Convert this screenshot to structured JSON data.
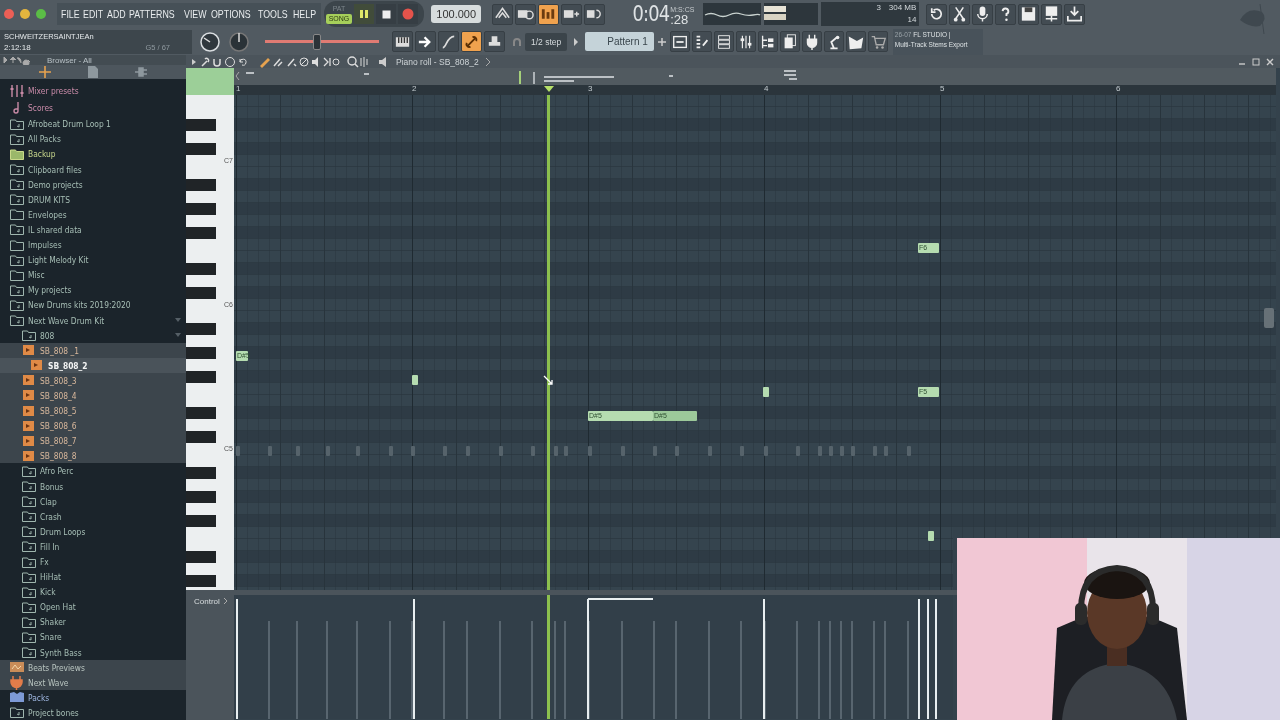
{
  "menu": [
    "FILE",
    "EDIT",
    "ADD",
    "PATTERNS",
    "VIEW",
    "OPTIONS",
    "TOOLS",
    "HELP"
  ],
  "transport": {
    "pat_label": "PAT",
    "song_label": "SONG",
    "song_mode": true,
    "playing": true,
    "tempo": "100.000",
    "time": "0:04",
    "time_small": ":28",
    "time_unit": "M:S:CS"
  },
  "toggles_top": [
    {
      "on": false
    },
    {
      "on": false
    },
    {
      "on": true
    },
    {
      "on": false
    },
    {
      "on": false
    }
  ],
  "toggles_bottom": [
    {
      "on": false
    },
    {
      "on": false
    },
    {
      "on": false
    },
    {
      "on": true
    },
    {
      "on": false
    }
  ],
  "cpu": {
    "value": "3",
    "memory": "304 MB",
    "voices": "14"
  },
  "hint": {
    "title": "SCHWEITZERSAINTJEAn",
    "time": "2:12:18",
    "note": "G5 / 67"
  },
  "pitch_slider": {
    "level": 0.45
  },
  "snap": "1/2 step",
  "pattern": "Pattern 1",
  "news": {
    "date": "26-07",
    "title": "FL STUDIO |",
    "subtitle": "Multi-Track Stems Export"
  },
  "browser": {
    "label": "Browser - All",
    "items": [
      {
        "label": "Mixer presets",
        "kind": "mixer",
        "selected": false
      },
      {
        "label": "Scores",
        "kind": "score",
        "selected": false
      },
      {
        "label": "Afrobeat Drum Loop 1",
        "kind": "folder-link",
        "selected": false
      },
      {
        "label": "All Packs",
        "kind": "folder-link",
        "selected": false
      },
      {
        "label": "Backup",
        "kind": "backup",
        "selected": false
      },
      {
        "label": "Clipboard files",
        "kind": "folder-link",
        "selected": false
      },
      {
        "label": "Demo projects",
        "kind": "folder-link",
        "selected": false
      },
      {
        "label": "DRUM KITS",
        "kind": "folder-link",
        "selected": false
      },
      {
        "label": "Envelopes",
        "kind": "folder",
        "selected": false
      },
      {
        "label": "IL shared data",
        "kind": "folder-link",
        "selected": false
      },
      {
        "label": "Impulses",
        "kind": "folder",
        "selected": false
      },
      {
        "label": "Light Melody Kit",
        "kind": "folder-link",
        "selected": false
      },
      {
        "label": "Misc",
        "kind": "folder",
        "selected": false
      },
      {
        "label": "My projects",
        "kind": "folder-link",
        "selected": false
      },
      {
        "label": "New Drums kits 2019:2020",
        "kind": "folder-link",
        "selected": false
      },
      {
        "label": "Next Wave Drum Kit",
        "kind": "folder-link",
        "selected": false,
        "expanded": true,
        "children": [
          {
            "label": "808",
            "kind": "folder-link",
            "selected": false,
            "expanded": true,
            "children": [
              {
                "label": "SB_808 _1",
                "kind": "sample",
                "selected": false
              },
              {
                "label": "SB_808_2",
                "kind": "sample",
                "selected": true
              },
              {
                "label": "SB_808_3",
                "kind": "sample",
                "selected": false
              },
              {
                "label": "SB_808_4",
                "kind": "sample",
                "selected": false
              },
              {
                "label": "SB_808_5",
                "kind": "sample",
                "selected": false
              },
              {
                "label": "SB_808_6",
                "kind": "sample",
                "selected": false
              },
              {
                "label": "SB_808_7",
                "kind": "sample",
                "selected": false
              },
              {
                "label": "SB_808_8",
                "kind": "sample",
                "selected": false
              }
            ]
          },
          {
            "label": "Afro Perc",
            "kind": "folder-link",
            "selected": false
          },
          {
            "label": "Bonus",
            "kind": "folder-link",
            "selected": false
          },
          {
            "label": "Clap",
            "kind": "folder-link",
            "selected": false
          },
          {
            "label": "Crash",
            "kind": "folder-link",
            "selected": false
          },
          {
            "label": "Drum Loops",
            "kind": "folder-link",
            "selected": false
          },
          {
            "label": "Fill In",
            "kind": "folder-link",
            "selected": false
          },
          {
            "label": "Fx",
            "kind": "folder-link",
            "selected": false
          },
          {
            "label": "HiHat",
            "kind": "folder-link",
            "selected": false
          },
          {
            "label": "Kick",
            "kind": "folder-link",
            "selected": false
          },
          {
            "label": "Open Hat",
            "kind": "folder-link",
            "selected": false
          },
          {
            "label": "Shaker",
            "kind": "folder-link",
            "selected": false
          },
          {
            "label": "Snare",
            "kind": "folder-link",
            "selected": false
          },
          {
            "label": "Synth Bass",
            "kind": "folder-link",
            "selected": false
          }
        ]
      },
      {
        "label": "Beats Previews",
        "kind": "beats",
        "selected": false
      },
      {
        "label": "Next Wave",
        "kind": "plugin",
        "selected": false
      },
      {
        "label": "Packs",
        "kind": "packs",
        "selected": false
      },
      {
        "label": "Project bones",
        "kind": "folder-link",
        "selected": false
      }
    ]
  },
  "piano_roll": {
    "title": "Piano roll - SB_808_2",
    "bars": [
      "1",
      "2",
      "3",
      "4",
      "5",
      "6"
    ],
    "keys": [
      "C7",
      "C6",
      "C5"
    ],
    "notes": [
      {
        "label": "D#5"
      },
      {
        "label": "F6"
      },
      {
        "label": "F5"
      },
      {
        "label": "D#5"
      },
      {
        "label": "D#5"
      }
    ],
    "control_label": "Control"
  }
}
